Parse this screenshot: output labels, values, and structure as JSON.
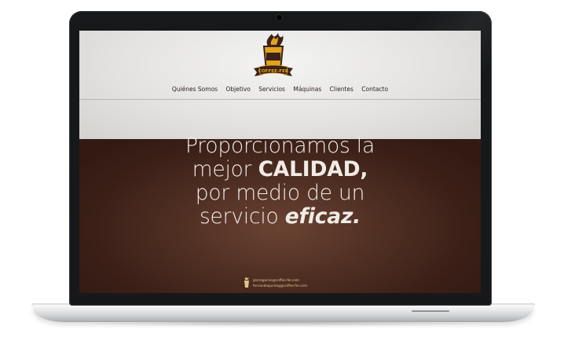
{
  "logo": {
    "brand_text": "COFFEE-FER"
  },
  "nav": {
    "items": [
      {
        "label": "Quiénes Somos"
      },
      {
        "label": "Objetivo"
      },
      {
        "label": "Servicios"
      },
      {
        "label": "Máquinas"
      },
      {
        "label": "Clientes"
      },
      {
        "label": "Contacto"
      }
    ]
  },
  "hero": {
    "line1": "Proporcionamos la",
    "line2_prefix": "mejor ",
    "line2_strong": "CALIDAD,",
    "line3": "por medio de un",
    "line4_prefix": "servicio ",
    "line4_emph": "eficaz."
  },
  "contact": {
    "email1": "gloriagarcia@coffee-fer.com",
    "email2": "fernandoquinteg@coffee-fer.com"
  },
  "colors": {
    "header_bg": "#e4e3e1",
    "hero_bg": "#4e2e22",
    "hero_text": "#f1ebe6",
    "logo_gold": "#e2a41f",
    "logo_brown": "#3b2119",
    "contact_text": "#e1c38a"
  }
}
